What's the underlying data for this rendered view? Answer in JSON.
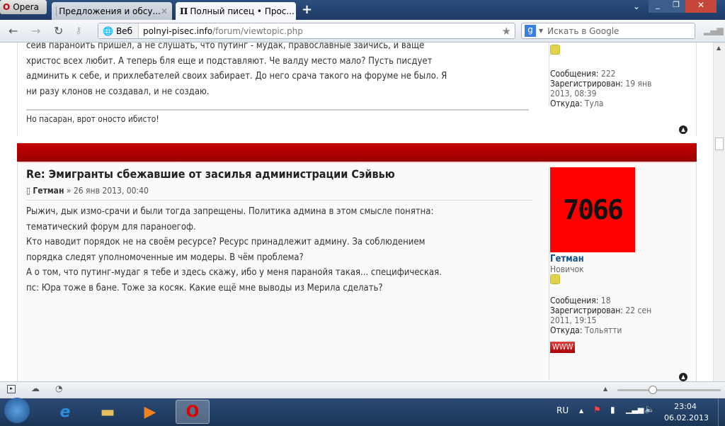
{
  "browser": {
    "opera_label": "Opera",
    "tabs": [
      {
        "title": "Предложения и обсу..."
      },
      {
        "title": "Полный писец • Прос..."
      }
    ],
    "address_badge": "Веб",
    "url_host": "polnyi-pisec.info",
    "url_path": "/forum/viewtopic.php",
    "search_placeholder": "Искать в Google"
  },
  "post1": {
    "lines": [
      "сейв параноить пришел, а не слушать, что путинг - мудак, православные зайчись, и ваще",
      "христос всех любит. А теперь бля еще и подставляют. Че валду место мало? Пусть писдует",
      "админить к себе, и прихлебателей своих забирает. До него срача такого на форуме не было. Я",
      "ни разу клонов не создавал, и не создаю."
    ],
    "signature": "Но пасаран, врот оносто ибисто!",
    "profile": {
      "posts_label": "Сообщения:",
      "posts": "222",
      "reg_label": "Зарегистрирован:",
      "reg": "19 янв",
      "reg2": "2013, 08:39",
      "from_label": "Откуда:",
      "from": "Тула"
    }
  },
  "post2": {
    "title": "Re: Эмигранты сбежавшие от засилья администрации Сэйвью",
    "author": "Гетман",
    "date": "» 26 янв 2013, 00:40",
    "lines": [
      "Рыжич, дык измо-срачи и были тогда запрещены. Политика админа в этом смысле понятна:",
      "тематический форум для параноегоф.",
      "Кто наводит порядок не на своём ресурсе? Ресурс принадлежит админу. За соблюдением",
      "порядка следят уполномоченные им модеры. В чём проблема?",
      "А о том, что путинг-мудаг я тебе и здесь скажу, ибо у меня паранойя такая... специфическая.",
      "пс: Юра тоже в бане. Тоже за косяк. Какие ещё мне выводы из Мерила сделать?"
    ],
    "avatar_text": "7066",
    "profile": {
      "name": "Гетман",
      "rank": "Новичок",
      "posts_label": "Сообщения:",
      "posts": "18",
      "reg_label": "Зарегистрирован:",
      "reg": "22 сен",
      "reg2": "2011, 19:15",
      "from_label": "Откуда:",
      "from": "Тольятти",
      "www": "WWW"
    }
  },
  "taskbar": {
    "lang": "RU",
    "time": "23:04",
    "date": "06.02.2013"
  },
  "colors": {
    "band": "#b00000",
    "avatar": "#ff0000",
    "link": "#105289"
  }
}
